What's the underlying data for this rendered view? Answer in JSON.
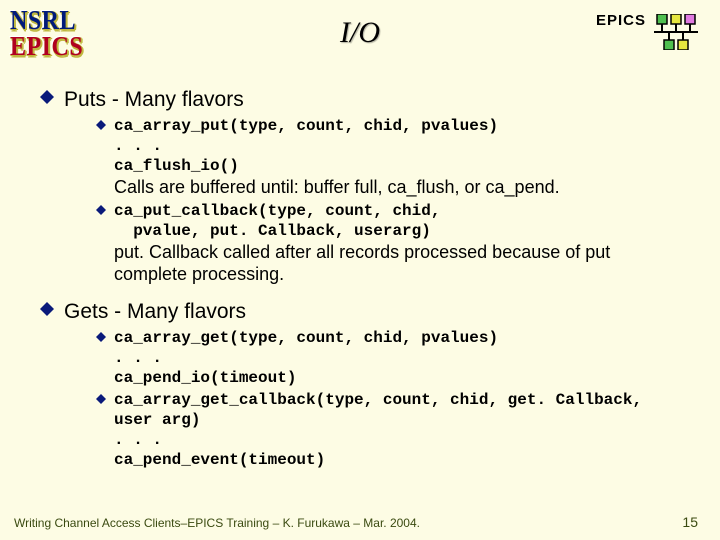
{
  "header": {
    "logo_nsrl": "NSRL",
    "logo_epics": "EPICS",
    "title": "I/O",
    "epics_label": "EPICS"
  },
  "sections": {
    "puts": {
      "heading": "Puts - Many flavors",
      "item1_code": "ca_array_put(type, count, chid, pvalues)\n. . .\nca_flush_io()",
      "item1_body": "Calls are buffered until:  buffer full, ca_flush, or ca_pend.",
      "item2_code": "ca_put_callback(type, count, chid,\n  pvalue, put. Callback, userarg)",
      "item2_body": "put. Callback called after all records processed because of put complete processing."
    },
    "gets": {
      "heading": "Gets - Many flavors",
      "item1_code": "ca_array_get(type, count, chid, pvalues)\n. . .\nca_pend_io(timeout)",
      "item2_code": "ca_array_get_callback(type, count, chid, get. Callback, user arg)\n. . .\nca_pend_event(timeout)"
    }
  },
  "footer": {
    "text": "Writing Channel Access Clients–EPICS Training – K. Furukawa – Mar. 2004.",
    "page": "15"
  }
}
